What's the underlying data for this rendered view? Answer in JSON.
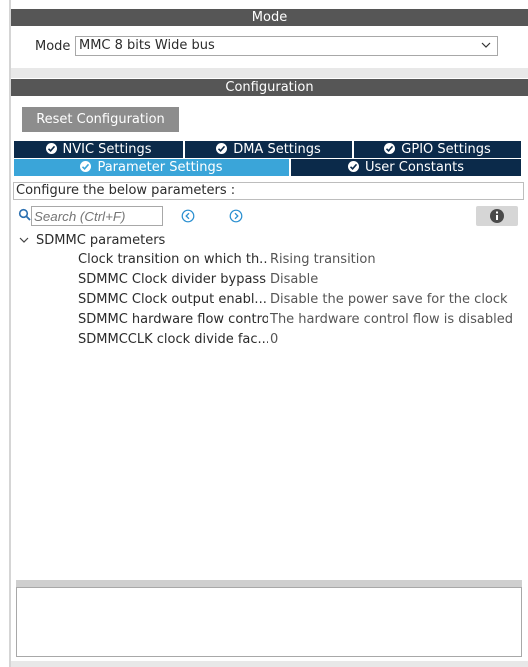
{
  "mode_section": {
    "header": "Mode",
    "mode_label": "Mode",
    "mode_value": "MMC 8 bits Wide bus"
  },
  "config_section": {
    "header": "Configuration",
    "reset_button": "Reset Configuration",
    "tabs_row1": [
      {
        "label": "NVIC Settings"
      },
      {
        "label": "DMA Settings"
      },
      {
        "label": "GPIO Settings"
      }
    ],
    "tabs_row2": [
      {
        "label": "Parameter Settings",
        "active": true
      },
      {
        "label": "User Constants"
      }
    ],
    "instruction": "Configure the below parameters :",
    "search_placeholder": "Search (Ctrl+F)",
    "tree": {
      "group": "SDMMC parameters",
      "params": [
        {
          "name": "Clock transition on which th...",
          "value": "Rising transition"
        },
        {
          "name": "SDMMC Clock divider bypass",
          "value": "Disable"
        },
        {
          "name": "SDMMC Clock output enabl...",
          "value": "Disable the power save for the clock"
        },
        {
          "name": "SDMMC hardware flow control",
          "value": "The hardware control flow is disabled"
        },
        {
          "name": "SDMMCCLK clock divide fac...",
          "value": "0"
        }
      ]
    }
  },
  "colors": {
    "header_bg": "#565656",
    "tab_bg": "#0b2a4a",
    "tab_active_bg": "#3aa5d9",
    "button_bg": "#8d8d8d"
  },
  "icons": [
    "check-circle-icon",
    "search-icon",
    "nav-prev-icon",
    "nav-next-icon",
    "info-icon",
    "chevron-down-icon"
  ]
}
